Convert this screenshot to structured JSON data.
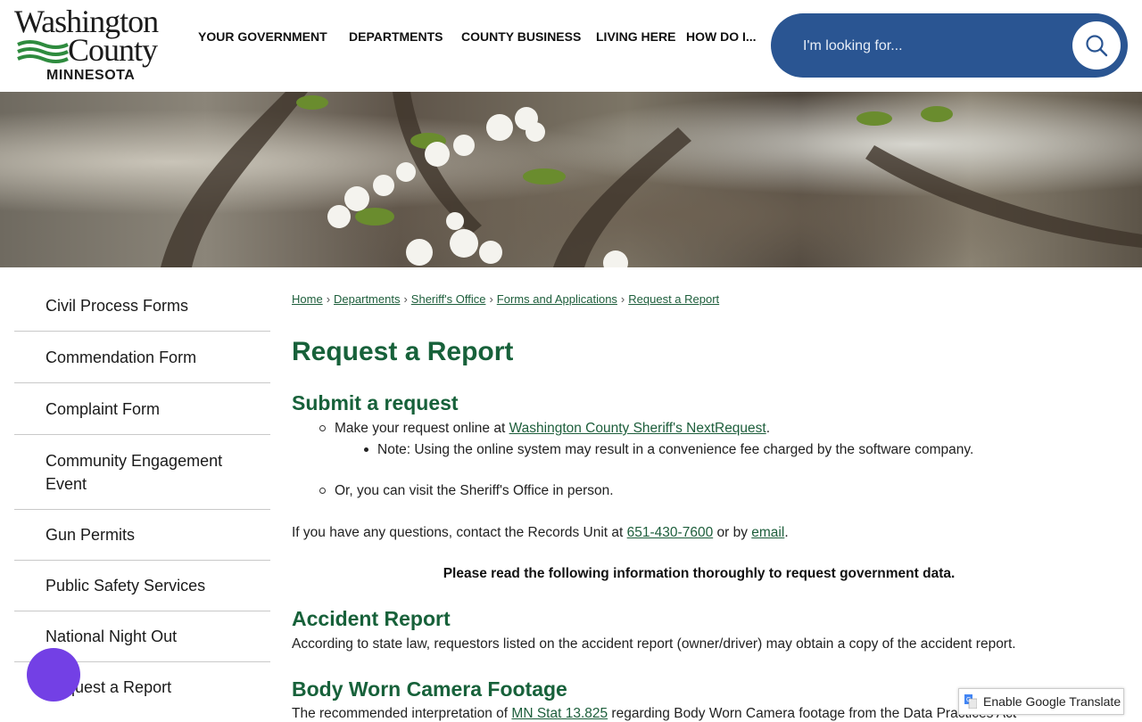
{
  "logo": {
    "line1": "Washington",
    "line2": "County",
    "state": "MINNESOTA"
  },
  "nav": [
    "YOUR GOVERNMENT",
    "DEPARTMENTS",
    "COUNTY BUSINESS",
    "LIVING HERE",
    "HOW DO I..."
  ],
  "search": {
    "placeholder": "I'm looking for..."
  },
  "sidebar": {
    "items": [
      "Civil Process Forms",
      "Commendation Form",
      "Complaint Form",
      "Community Engagement Event",
      "Gun Permits",
      "Public Safety Services",
      "National Night Out",
      "Request a Report"
    ]
  },
  "breadcrumb": [
    "Home",
    "Departments",
    "Sheriff's Office",
    "Forms and Applications",
    "Request a Report"
  ],
  "page": {
    "title": "Request a Report",
    "submit_heading": "Submit a request",
    "online_prefix": "Make your request online at ",
    "online_link": "Washington County Sheriff's NextRequest",
    "online_suffix": ".",
    "note": "Note: Using the online system may result in a convenience fee charged by the software company.",
    "in_person": "Or, you can visit the Sheriff's Office in person.",
    "contact_prefix": "If you have any questions, contact the Records Unit at ",
    "phone": "651-430-7600",
    "contact_mid": " or by ",
    "email": "email",
    "contact_suffix": ".",
    "notice": "Please read the following information thoroughly to request government data.",
    "accident_heading": "Accident Report",
    "accident_text": "According to state law, requestors listed on the accident report (owner/driver) may obtain a copy of the accident report.",
    "bodycam_heading": "Body Worn Camera Footage",
    "bodycam_text_prefix": "The recommended interpretation of ",
    "bodycam_link": "MN Stat 13.825",
    "bodycam_text_suffix": " regarding Body Worn Camera footage from the Data Practices Act"
  },
  "translate": {
    "label": "Enable Google Translate"
  },
  "colors": {
    "accent_green": "#17613a",
    "search_blue": "#2a5592",
    "a11y_purple": "#7340e5"
  }
}
